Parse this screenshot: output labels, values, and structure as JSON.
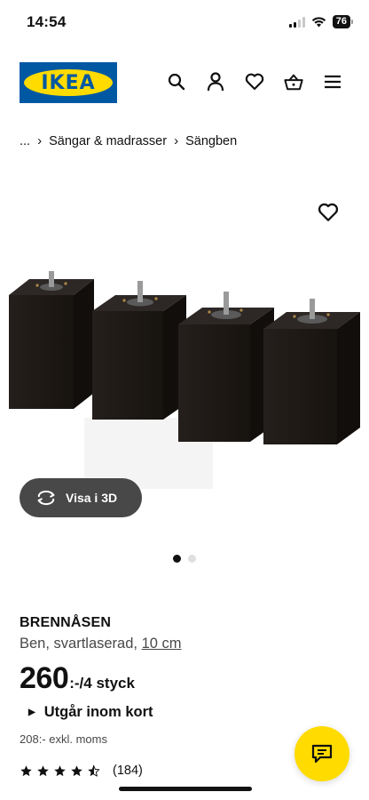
{
  "status_bar": {
    "time": "14:54",
    "battery": "76"
  },
  "header": {
    "logo_text": "IKEA"
  },
  "breadcrumb": {
    "ellipsis": "...",
    "items": [
      "Sängar & madrasser",
      "Sängben"
    ]
  },
  "gallery": {
    "view_3d_label": "Visa i 3D",
    "active_index": 0,
    "total": 2
  },
  "product": {
    "name": "BRENNÅSEN",
    "description": "Ben, svartlaserad,",
    "size": "10 cm",
    "price": "260",
    "price_suffix": ":-/4 styck",
    "availability": "Utgår inom kort",
    "price_excl": "208:- exkl. moms",
    "rating_value": 4.5,
    "rating_count": "(184)"
  },
  "colors": {
    "ikea_blue": "#0058a3",
    "ikea_yellow": "#ffdb00",
    "button_dark": "#484848",
    "leg_black": "#1e1b19"
  }
}
